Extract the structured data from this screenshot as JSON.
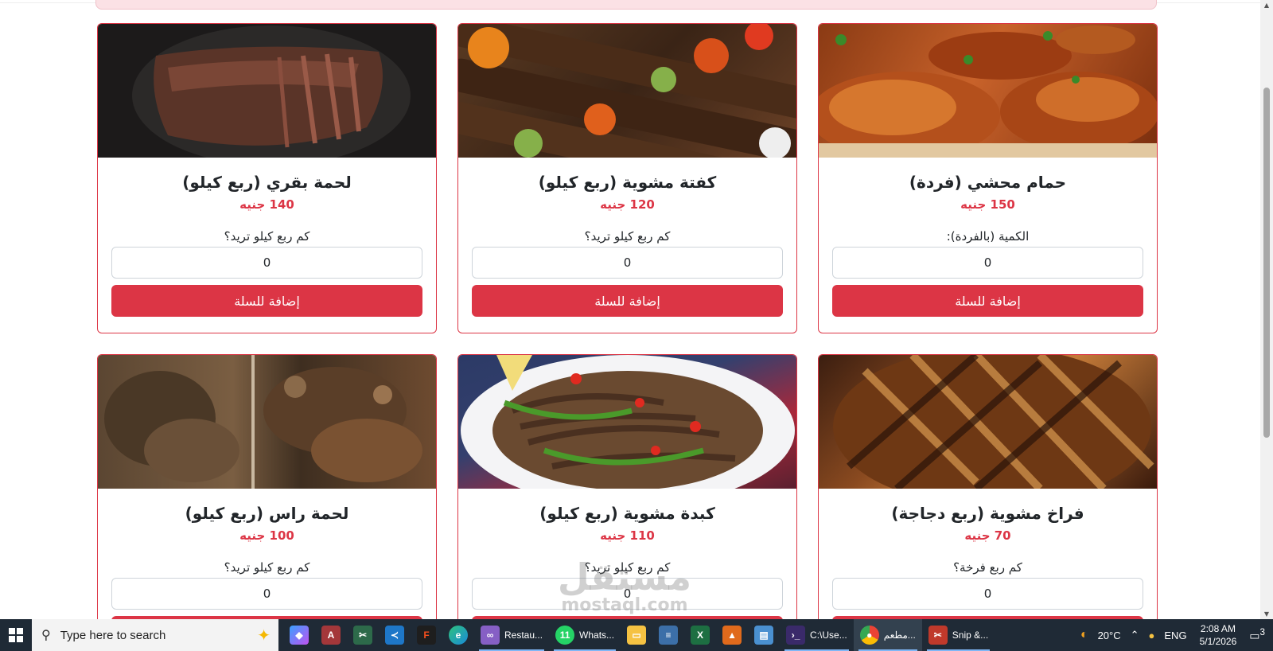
{
  "menu": {
    "add_label": "إضافة للسلة",
    "items": [
      {
        "title": "حمام محشي (فردة)",
        "price": "150 جنيه",
        "qty_label": "الكمية (بالفردة):",
        "qty": "0"
      },
      {
        "title": "كفتة مشوية (ربع كيلو)",
        "price": "120 جنيه",
        "qty_label": "كم ربع كيلو تريد؟",
        "qty": "0"
      },
      {
        "title": "لحمة بقري (ربع كيلو)",
        "price": "140 جنيه",
        "qty_label": "كم ربع كيلو تريد؟",
        "qty": "0"
      },
      {
        "title": "فراخ مشوية (ربع دجاجة)",
        "price": "70 جنيه",
        "qty_label": "كم ربع فرخة؟",
        "qty": "0"
      },
      {
        "title": "كبدة مشوية (ربع كيلو)",
        "price": "110 جنيه",
        "qty_label": "كم ربع كيلو تريد؟",
        "qty": "0"
      },
      {
        "title": "لحمة راس (ربع كيلو)",
        "price": "100 جنيه",
        "qty_label": "كم ربع كيلو تريد؟",
        "qty": "0"
      }
    ]
  },
  "watermark": {
    "arabic": "مستقل",
    "latin": "mostaql.com"
  },
  "taskbar": {
    "search_placeholder": "Type here to search",
    "apps": [
      {
        "name": "copilot",
        "label": ""
      },
      {
        "name": "access",
        "label": ""
      },
      {
        "name": "snipping",
        "label": ""
      },
      {
        "name": "vscode",
        "label": ""
      },
      {
        "name": "figma",
        "label": ""
      },
      {
        "name": "edge",
        "label": ""
      },
      {
        "name": "visual-studio",
        "label": "Restau..."
      },
      {
        "name": "whatsapp",
        "label": "Whats..."
      },
      {
        "name": "explorer",
        "label": ""
      },
      {
        "name": "stack",
        "label": ""
      },
      {
        "name": "excel",
        "label": ""
      },
      {
        "name": "matlab",
        "label": ""
      },
      {
        "name": "files",
        "label": ""
      },
      {
        "name": "terminal",
        "label": "C:\\Use..."
      },
      {
        "name": "chrome",
        "label": "مطعم..."
      },
      {
        "name": "snip-sketch",
        "label": "Snip &..."
      }
    ],
    "whatsapp_badge": "11",
    "weather": "20°C",
    "language": "ENG",
    "time": "2:08 AM",
    "date": "5/1/2026",
    "notifications": "3"
  }
}
